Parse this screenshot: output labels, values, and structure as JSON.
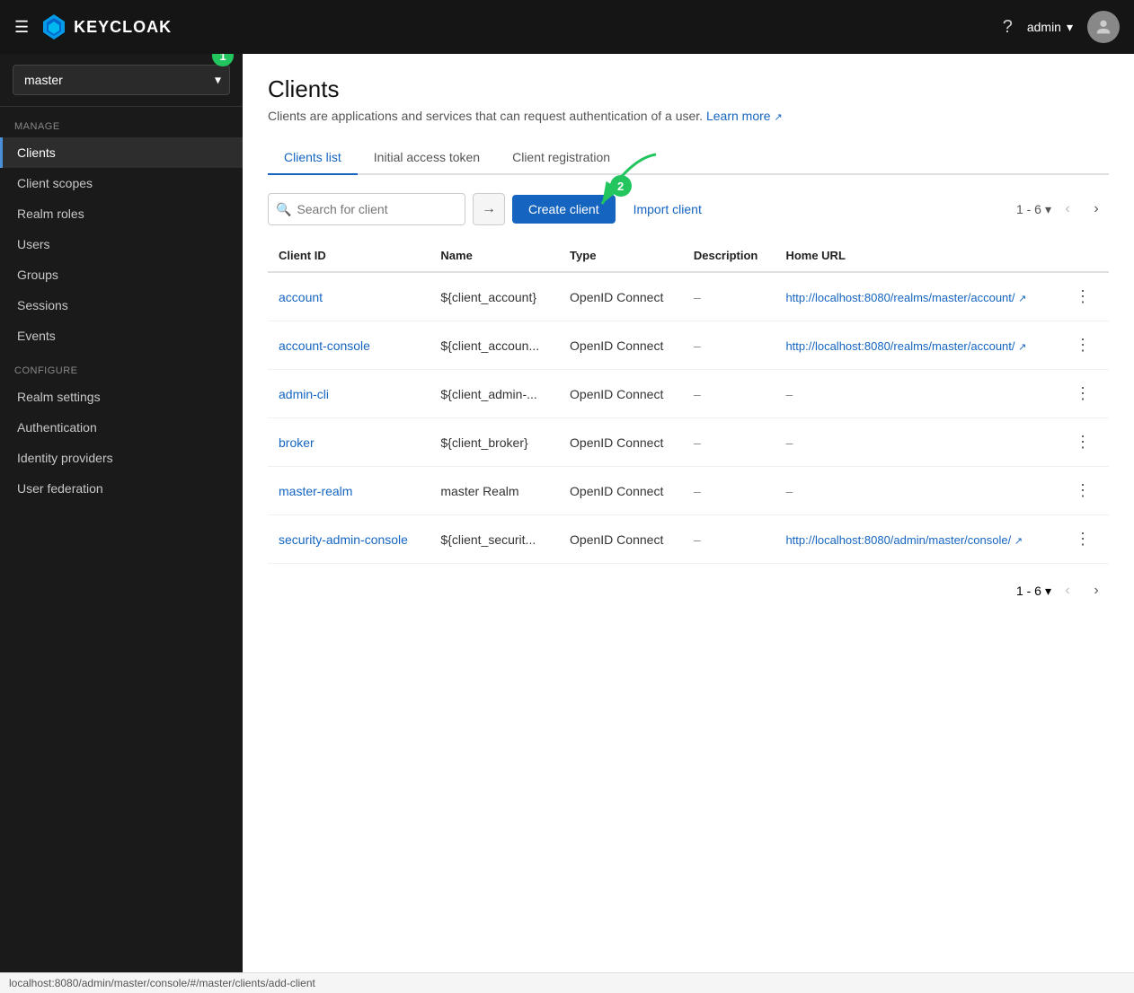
{
  "navbar": {
    "menu_icon": "☰",
    "logo_text": "KEYCLOAK",
    "help_title": "Help",
    "user_name": "admin",
    "dropdown_icon": "▾"
  },
  "sidebar": {
    "realm": "master",
    "manage_label": "Manage",
    "items_manage": [
      {
        "id": "clients",
        "label": "Clients",
        "active": true
      },
      {
        "id": "client-scopes",
        "label": "Client scopes",
        "active": false
      },
      {
        "id": "realm-roles",
        "label": "Realm roles",
        "active": false
      },
      {
        "id": "users",
        "label": "Users",
        "active": false
      },
      {
        "id": "groups",
        "label": "Groups",
        "active": false
      },
      {
        "id": "sessions",
        "label": "Sessions",
        "active": false
      },
      {
        "id": "events",
        "label": "Events",
        "active": false
      }
    ],
    "configure_label": "Configure",
    "items_configure": [
      {
        "id": "realm-settings",
        "label": "Realm settings",
        "active": false
      },
      {
        "id": "authentication",
        "label": "Authentication",
        "active": false
      },
      {
        "id": "identity-providers",
        "label": "Identity providers",
        "active": false
      },
      {
        "id": "user-federation",
        "label": "User federation",
        "active": false
      }
    ]
  },
  "page": {
    "title": "Clients",
    "subtitle": "Clients are applications and services that can request authentication of a user.",
    "learn_more": "Learn more",
    "learn_more_icon": "↗"
  },
  "tabs": [
    {
      "id": "clients-list",
      "label": "Clients list",
      "active": true
    },
    {
      "id": "initial-access-token",
      "label": "Initial access token",
      "active": false
    },
    {
      "id": "client-registration",
      "label": "Client registration",
      "active": false
    }
  ],
  "toolbar": {
    "search_placeholder": "Search for client",
    "go_icon": "→",
    "create_label": "Create client",
    "import_label": "Import client",
    "pagination": "1 - 6",
    "pagination_dropdown": "▾"
  },
  "table": {
    "columns": [
      "Client ID",
      "Name",
      "Type",
      "Description",
      "Home URL"
    ],
    "rows": [
      {
        "client_id": "account",
        "name": "${client_account}",
        "type": "OpenID Connect",
        "description": "–",
        "home_url": "http://localhost:8080/realms/master/account/",
        "has_url": true
      },
      {
        "client_id": "account-console",
        "name": "${client_accoun...",
        "type": "OpenID Connect",
        "description": "–",
        "home_url": "http://localhost:8080/realms/master/account/",
        "has_url": true
      },
      {
        "client_id": "admin-cli",
        "name": "${client_admin-...",
        "type": "OpenID Connect",
        "description": "–",
        "home_url": "–",
        "has_url": false
      },
      {
        "client_id": "broker",
        "name": "${client_broker}",
        "type": "OpenID Connect",
        "description": "–",
        "home_url": "–",
        "has_url": false
      },
      {
        "client_id": "master-realm",
        "name": "master Realm",
        "type": "OpenID Connect",
        "description": "–",
        "home_url": "–",
        "has_url": false
      },
      {
        "client_id": "security-admin-console",
        "name": "${client_securit...",
        "type": "OpenID Connect",
        "description": "–",
        "home_url": "http://localhost:8080/admin/master/console/",
        "has_url": true
      }
    ]
  },
  "pagination_bottom": "1 - 6",
  "status_bar": {
    "url": "localhost:8080/admin/master/console/#/master/clients/add-client"
  },
  "annotations": {
    "badge1": "1",
    "badge2": "2"
  }
}
